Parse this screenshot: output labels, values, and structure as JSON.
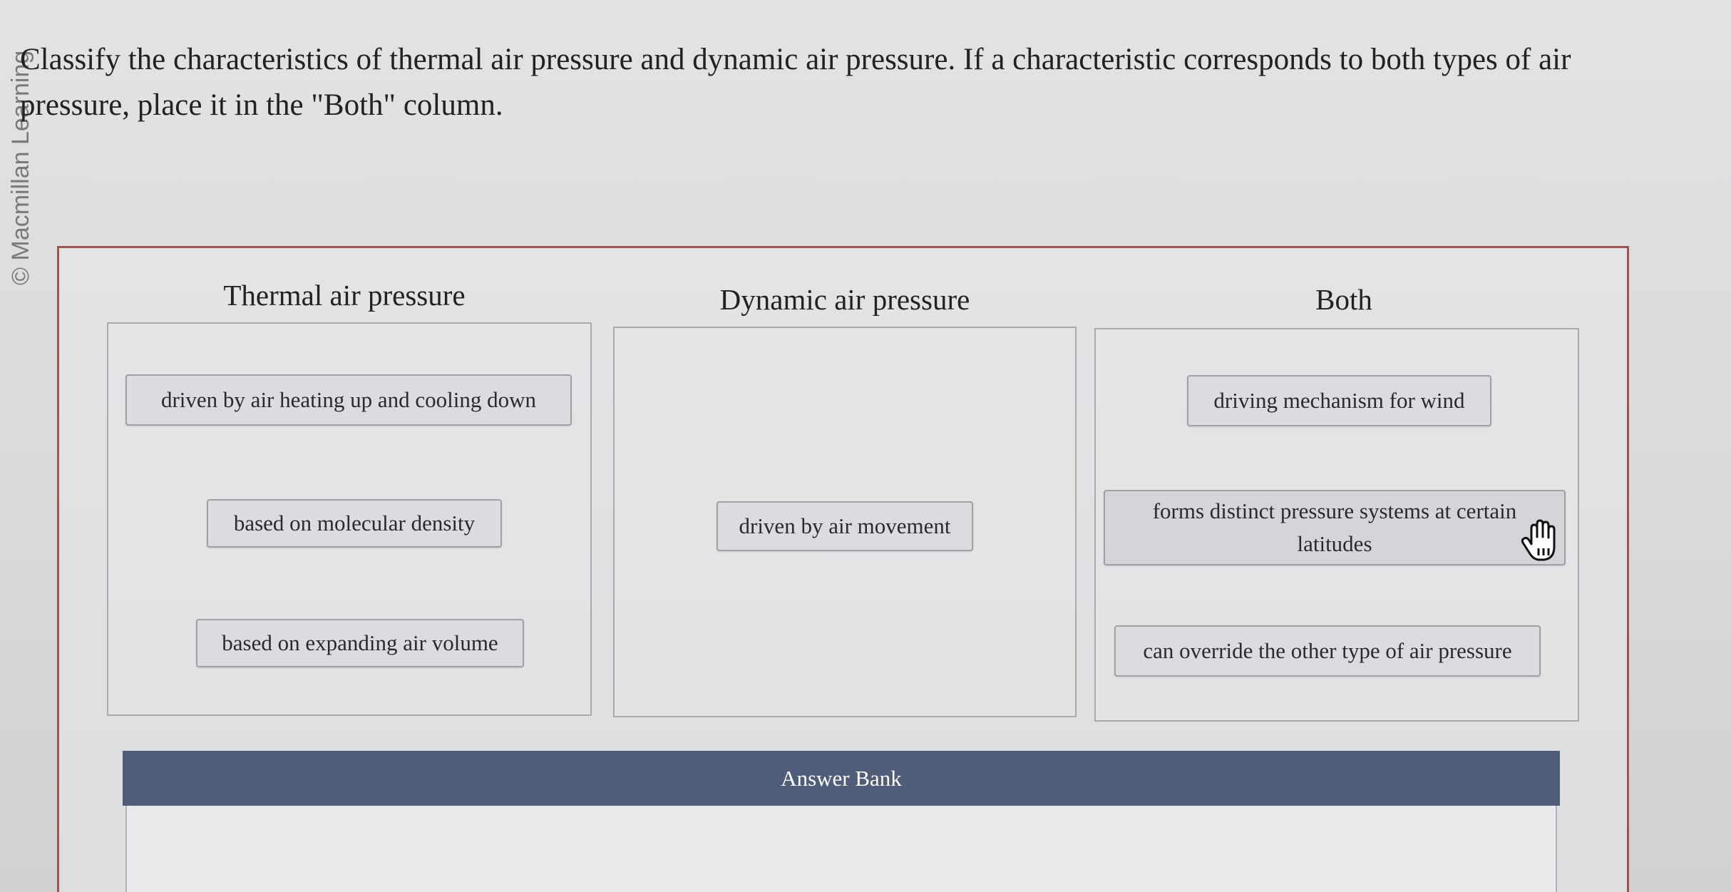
{
  "watermark": "© Macmillan Learning",
  "question": "Classify the characteristics of thermal air pressure and dynamic air pressure. If a characteristic corresponds to both types of air pressure, place it in the \"Both\" column.",
  "columns": [
    {
      "title": "Thermal air pressure",
      "items": [
        "driven by air heating up and cooling down",
        "based on molecular density",
        "based on expanding air volume"
      ]
    },
    {
      "title": "Dynamic air pressure",
      "items": [
        "driven by air movement"
      ]
    },
    {
      "title": "Both",
      "items": [
        "driving mechanism for wind",
        "forms distinct pressure systems at certain latitudes",
        "can override the other type of air pressure"
      ]
    }
  ],
  "answer_bank": {
    "label": "Answer Bank"
  },
  "icons": {
    "cursor": "grab-hand-icon"
  }
}
